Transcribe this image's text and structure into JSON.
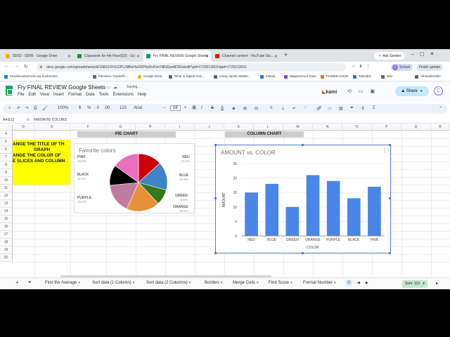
{
  "browser": {
    "tabs": [
      {
        "label": "03/02 - 03/05 - Google Drive",
        "color": "#f4b400"
      },
      {
        "label": "Classwork for 4th Hour(Q3) - Go",
        "color": "#1e8e3e"
      },
      {
        "label": "Fry FINAL REVIEW Google Sheets",
        "color": "#0f9d58"
      },
      {
        "label": "Channel content - YouTube Stu...",
        "color": "#ff0000"
      }
    ],
    "ask_gemini": "Ask Gemini",
    "url": "docs.google.com/spreadsheets/d/1SE51VtVUCPLX8BeHaOEP6zDvlOroY8NZpzdlD92s/edit?gid=1729213501#gid=1729213501",
    "profile_chip": "School",
    "finish_update": "Finish update",
    "bookmarks": [
      {
        "label": "hazelwoodschools.org bookmarks",
        "color": "#1a73e8"
      },
      {
        "label": "Introduce Yourself i...",
        "color": "#5f6368"
      },
      {
        "label": "Google Drive",
        "color": "#f4b400"
      },
      {
        "label": "What Is Digital Citiz...",
        "color": "#5f6368"
      },
      {
        "label": "Using Sports Statisti...",
        "color": "#5f6368"
      },
      {
        "label": "Infinite",
        "color": "#1a73e8"
      },
      {
        "label": "MagicSchool Tools",
        "color": "#7b3fe4"
      },
      {
        "label": "POWER HOUR",
        "color": "#e8710a"
      },
      {
        "label": "TalentEd",
        "color": "#1a73e8"
      },
      {
        "label": "desr",
        "color": "#5f6368"
      },
      {
        "label": "All Bookmarks",
        "color": "#5f6368"
      }
    ]
  },
  "sheets": {
    "title": "Fry FINAL REVIEW Google Sheets",
    "saving": "Saving...",
    "menu": [
      "File",
      "Edit",
      "View",
      "Insert",
      "Format",
      "Data",
      "Tools",
      "Extensions",
      "Help"
    ],
    "kami": "kami",
    "share": "Share",
    "avatar": "C",
    "toolbar": {
      "zoom": "100%",
      "currency": "$",
      "percent": "%",
      "decimal_dec": ".0",
      "decimal_inc": ".00",
      "number_format": "123",
      "font": "Arial",
      "font_size": "16",
      "bold": "B",
      "italic": "I",
      "strike": "S",
      "text_color": "A"
    },
    "cell_ref": "A4:E12",
    "formula_content": "FAVORITE COLORS",
    "columns": [
      "D",
      "E",
      "F",
      "G",
      "H",
      "I",
      "J",
      "K",
      "L",
      "M",
      "N",
      "O",
      "P",
      "Q",
      "R"
    ],
    "rows": [
      "4",
      "5",
      "6",
      "7",
      "8",
      "9",
      "10",
      "11",
      "12",
      "13",
      "14",
      "15",
      "16",
      "17",
      "18",
      "19",
      "20"
    ],
    "pie_header": "PIE CHART",
    "column_header": "COLUMN CHART",
    "instructions": [
      "ANGE THE TITLE OF THE",
      "GRAPH",
      "ANGE THE COLOR OF",
      "E SLICES AND COLUMNS"
    ],
    "sheet_tabs": [
      "Find the Average",
      "Sort data (1 Column)",
      "Sort data (2 Columns)",
      "Borders",
      "Merge Cells",
      "Find Score",
      "Format Number",
      "G"
    ],
    "sum": "Sum: 113"
  },
  "pie_chart": {
    "title": "Favorite colors",
    "slices": [
      {
        "label": "RED",
        "pct": "13.3%",
        "value": 15,
        "color": "#cc0000"
      },
      {
        "label": "BLUE",
        "pct": "15.9%",
        "value": 18,
        "color": "#3d85c6"
      },
      {
        "label": "GREEN",
        "pct": "8.8%",
        "value": 10,
        "color": "#38761d"
      },
      {
        "label": "ORANGE",
        "pct": "18.6%",
        "value": 21,
        "color": "#e69138"
      },
      {
        "label": "PURPLE",
        "pct": "16.8%",
        "value": 19,
        "color": "#c27ba0"
      },
      {
        "label": "BLACK",
        "pct": "11.5%",
        "value": 13,
        "color": "#000000"
      },
      {
        "label": "PINK",
        "pct": "15.0%",
        "value": 17,
        "color": "#ec6ec0"
      }
    ]
  },
  "chart_data": {
    "type": "bar",
    "title": "AMOUNT vs. COLOR",
    "xlabel": "COLOR",
    "ylabel": "AMOUNT",
    "categories": [
      "RED",
      "BLUE",
      "GREEN",
      "ORANGE",
      "PURPLE",
      "BLACK",
      "PINK"
    ],
    "values": [
      15,
      18,
      10,
      21,
      19,
      13,
      17
    ],
    "ylim": [
      0,
      25
    ],
    "yticks": [
      "0",
      "5",
      "10",
      "15",
      "20",
      "25"
    ],
    "bar_color": "#4a86e8",
    "grid": true
  }
}
